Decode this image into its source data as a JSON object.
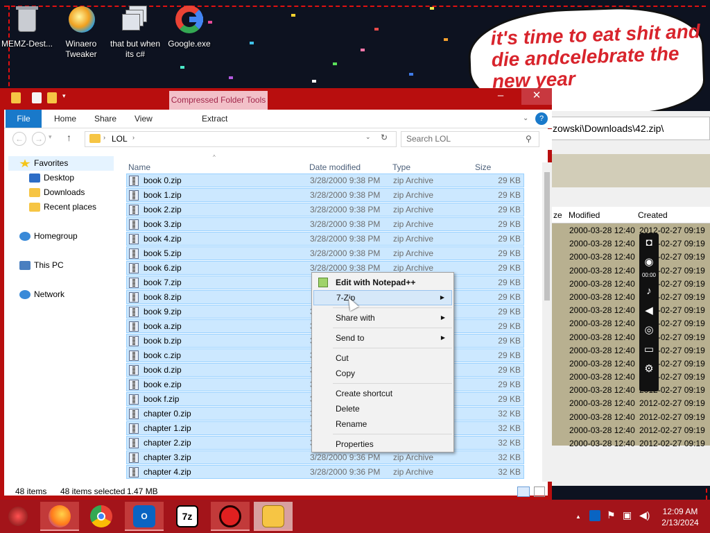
{
  "desktop": {
    "icons": [
      {
        "label": "MEMZ-Dest...",
        "icon": "recycle-bin-icon"
      },
      {
        "label": "Winaero Tweaker",
        "icon": "winaero-icon"
      },
      {
        "label": "that but when its c#",
        "icon": "shortcut-icon"
      },
      {
        "label": "Google.exe",
        "icon": "google-icon"
      }
    ],
    "meme_text": "it's time to eat shit and die andcelebrate the new year"
  },
  "background_window": {
    "address": "zowski\\Downloads\\42.zip\\",
    "headers": [
      "ze",
      "Modified",
      "Created"
    ],
    "rows": [
      {
        "modified": "2000-03-28 12:40",
        "created": "2012-02-27 09:19"
      },
      {
        "modified": "2000-03-28 12:40",
        "created": "2012-02-27 09:19"
      },
      {
        "modified": "2000-03-28 12:40",
        "created": "2012-02-27 09:19"
      },
      {
        "modified": "2000-03-28 12:40",
        "created": "2012-02-27 09:19"
      },
      {
        "modified": "2000-03-28 12:40",
        "created": "2012-02-27 09:19"
      },
      {
        "modified": "2000-03-28 12:40",
        "created": "2012-02-27 09:19"
      },
      {
        "modified": "2000-03-28 12:40",
        "created": "2012-02-27 09:19"
      },
      {
        "modified": "2000-03-28 12:40",
        "created": "2012-02-27 09:19"
      },
      {
        "modified": "2000-03-28 12:40",
        "created": "2012-02-27 09:19"
      },
      {
        "modified": "2000-03-28 12:40",
        "created": "2012-02-27 09:19"
      },
      {
        "modified": "2000-03-28 12:40",
        "created": "2012-02-27 09:19"
      },
      {
        "modified": "2000-03-28 12:40",
        "created": "2012-02-27 09:19"
      },
      {
        "modified": "2000-03-28 12:40",
        "created": "2012-02-27 09:19"
      },
      {
        "modified": "2000-03-28 12:40",
        "created": "2012-02-27 09:19"
      },
      {
        "modified": "2000-03-28 12:40",
        "created": "2012-02-27 09:19"
      },
      {
        "modified": "2000-03-28 12:40",
        "created": "2012-02-27 09:19"
      },
      {
        "modified": "2000-03-28 12:40",
        "created": "2012-02-27 09:19"
      }
    ],
    "recorder_timer": "00:00"
  },
  "explorer": {
    "contextual_tab": "Compressed Folder Tools",
    "tabs": [
      "File",
      "Home",
      "Share",
      "View"
    ],
    "extract_label": "Extract",
    "breadcrumb": "LOL",
    "search_placeholder": "Search LOL",
    "nav": {
      "favorites": "Favorites",
      "desktop": "Desktop",
      "downloads": "Downloads",
      "recent": "Recent places",
      "homegroup": "Homegroup",
      "thispc": "This PC",
      "network": "Network"
    },
    "columns": [
      "Name",
      "Date modified",
      "Type",
      "Size"
    ],
    "files": [
      {
        "name": "book 0.zip",
        "date": "3/28/2000 9:38 PM",
        "type": "zip Archive",
        "size": "29 KB"
      },
      {
        "name": "book 1.zip",
        "date": "3/28/2000 9:38 PM",
        "type": "zip Archive",
        "size": "29 KB"
      },
      {
        "name": "book 2.zip",
        "date": "3/28/2000 9:38 PM",
        "type": "zip Archive",
        "size": "29 KB"
      },
      {
        "name": "book 3.zip",
        "date": "3/28/2000 9:38 PM",
        "type": "zip Archive",
        "size": "29 KB"
      },
      {
        "name": "book 4.zip",
        "date": "3/28/2000 9:38 PM",
        "type": "zip Archive",
        "size": "29 KB"
      },
      {
        "name": "book 5.zip",
        "date": "3/28/2000 9:38 PM",
        "type": "zip Archive",
        "size": "29 KB"
      },
      {
        "name": "book 6.zip",
        "date": "3/28/2000 9:38 PM",
        "type": "zip Archive",
        "size": "29 KB"
      },
      {
        "name": "book 7.zip",
        "date": "",
        "type": "",
        "size": "29 KB"
      },
      {
        "name": "book 8.zip",
        "date": "",
        "type": "",
        "size": "29 KB"
      },
      {
        "name": "book 9.zip",
        "date": "3",
        "type": "",
        "size": "29 KB"
      },
      {
        "name": "book a.zip",
        "date": "3",
        "type": "",
        "size": "29 KB"
      },
      {
        "name": "book b.zip",
        "date": "3",
        "type": "",
        "size": "29 KB"
      },
      {
        "name": "book c.zip",
        "date": "3",
        "type": "",
        "size": "29 KB"
      },
      {
        "name": "book d.zip",
        "date": "3",
        "type": "",
        "size": "29 KB"
      },
      {
        "name": "book e.zip",
        "date": "3",
        "type": "",
        "size": "29 KB"
      },
      {
        "name": "book f.zip",
        "date": "3",
        "type": "",
        "size": "29 KB"
      },
      {
        "name": "chapter 0.zip",
        "date": "3",
        "type": "",
        "size": "32 KB"
      },
      {
        "name": "chapter 1.zip",
        "date": "3",
        "type": "",
        "size": "32 KB"
      },
      {
        "name": "chapter 2.zip",
        "date": "3",
        "type": "",
        "size": "32 KB"
      },
      {
        "name": "chapter 3.zip",
        "date": "3/28/2000 9:36 PM",
        "type": "zip Archive",
        "size": "32 KB"
      },
      {
        "name": "chapter 4.zip",
        "date": "3/28/2000 9:36 PM",
        "type": "zip Archive",
        "size": "32 KB"
      }
    ],
    "status": {
      "items": "48 items",
      "selected": "48 items selected",
      "size": "1.47 MB"
    }
  },
  "context_menu": {
    "edit_notepad": "Edit with Notepad++",
    "sevenzip": "7-Zip",
    "share_with": "Share with",
    "send_to": "Send to",
    "cut": "Cut",
    "copy": "Copy",
    "create_shortcut": "Create shortcut",
    "delete": "Delete",
    "rename": "Rename",
    "properties": "Properties"
  },
  "taskbar": {
    "apps": [
      "firefox-icon",
      "chrome-icon",
      "outlook-icon",
      "7zip-icon",
      "recorder-icon",
      "file-explorer-icon"
    ],
    "time": "12:09 AM",
    "date": "2/13/2024"
  },
  "colors": {
    "theme_red": "#b80e0e",
    "selection": "#cce8ff",
    "file_tab": "#1979ca"
  }
}
